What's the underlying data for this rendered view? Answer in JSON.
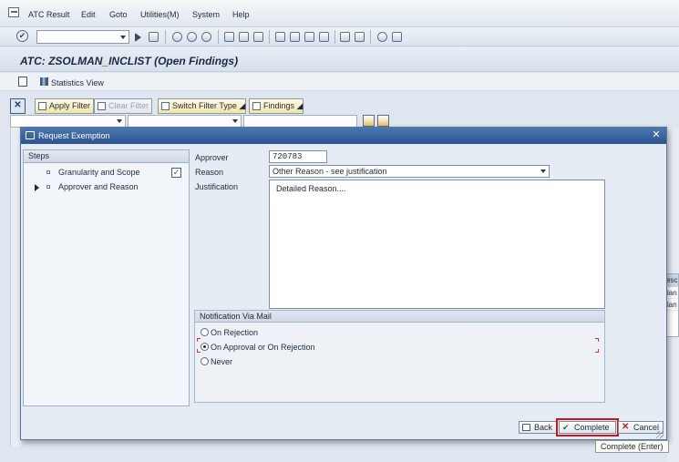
{
  "menubar": {
    "items": [
      "ATC Result",
      "Edit",
      "Goto",
      "Utilities(M)",
      "System",
      "Help"
    ]
  },
  "toolbar": {
    "command_value": ""
  },
  "header": {
    "title": "ATC: ZSOLMAN_INCLIST (Open Findings)"
  },
  "app_toolbar": {
    "statistics_view": "Statistics View"
  },
  "filter_bar": {
    "apply_filter": "Apply Filter",
    "clear_filter": "Clear Filter",
    "switch_filter_type": "Switch Filter Type",
    "findings": "Findings"
  },
  "background_table": {
    "header": "escr",
    "rows": [
      "lan",
      "lan"
    ]
  },
  "dialog": {
    "title": "Request Exemption",
    "steps_header": "Steps",
    "steps": [
      {
        "label": "Granularity and Scope",
        "done": true,
        "current": false
      },
      {
        "label": "Approver and Reason",
        "done": false,
        "current": true
      }
    ],
    "form": {
      "approver_label": "Approver",
      "approver_value": "720783",
      "reason_label": "Reason",
      "reason_value": "Other Reason - see justification",
      "justification_label": "Justification",
      "justification_value": "Detailed Reason...."
    },
    "notification": {
      "header": "Notification Via Mail",
      "options": [
        "On Rejection",
        "On Approval or On Rejection",
        "Never"
      ],
      "selected": "On Approval or On Rejection"
    },
    "buttons": {
      "back": "Back",
      "complete": "Complete",
      "cancel": "Cancel"
    }
  },
  "tooltip": {
    "text": "Complete   (Enter)"
  },
  "colors": {
    "dialog_header": "#2c5592",
    "highlight_outline": "#d0141b",
    "button_yellow": "#f1e5a8"
  }
}
